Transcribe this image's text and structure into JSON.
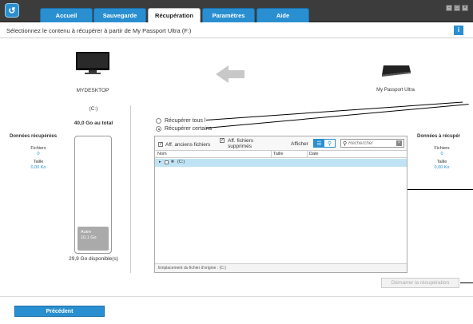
{
  "tabs": [
    {
      "label": "Accueil"
    },
    {
      "label": "Sauvegarde"
    },
    {
      "label": "Récupération"
    },
    {
      "label": "Paramètres"
    },
    {
      "label": "Aide"
    }
  ],
  "header": {
    "instruction": "Sélectionnez le contenu à récupérer à partir de My Passport Ultra (F:)",
    "help_icon": "i"
  },
  "source": {
    "name": "MYDESKTOP",
    "drive": "(C:)",
    "total": "40,0 Go au total",
    "free": "29,9 Go disponible(s)",
    "used_label": "Autre",
    "used_size": "10,1 Go",
    "used_fraction": 0.25
  },
  "target": {
    "name": "My Passport Ultra"
  },
  "left_panel": {
    "title": "Données récupérées",
    "files_label": "Fichiers",
    "files_value": "0",
    "size_label": "Taille",
    "size_value": "0,00 Ko"
  },
  "right_panel": {
    "title": "Données à récupér",
    "files_label": "Fichiers",
    "files_value": "0",
    "size_label": "Taille",
    "size_value": "0,00 Ko"
  },
  "options": {
    "recover_all": "Récupérer tous l",
    "recover_some": "Récupérer certains",
    "selected": "recover_some"
  },
  "browser": {
    "show_old_label": "Aff. anciens fichiers",
    "show_deleted_label": "Aff. fichiers supprimés",
    "view_label": "Afficher",
    "search_placeholder": "Rechercher",
    "columns": [
      "Nom",
      "Taille",
      "Date"
    ],
    "rows": [
      {
        "name": "(C:)"
      }
    ],
    "origin_label": "Emplacement du fichier d'origine :",
    "origin_value": "(C:)"
  },
  "actions": {
    "start": "Démarrer la récupération",
    "previous": "Précédent"
  },
  "colors": {
    "accent": "#2a8fd0",
    "titlebar": "#3c3c3c",
    "selected_row": "#bfe3f5"
  }
}
